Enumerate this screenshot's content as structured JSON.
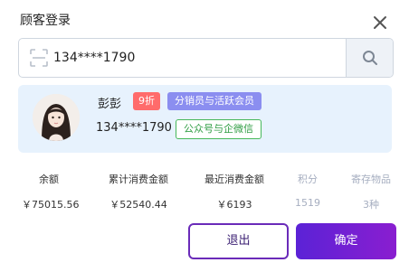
{
  "dialog": {
    "title": "顾客登录"
  },
  "search": {
    "value": "134****1790",
    "placeholder": ""
  },
  "customer": {
    "name": "彭彭",
    "discount_badge": "9折",
    "role_badge": "分销员与活跃会员",
    "phone": "134****1790",
    "channel_badge": "公众号与企微信"
  },
  "stats": [
    {
      "label": "余额",
      "value": "￥75015.56",
      "muted": false
    },
    {
      "label": "累计消费金额",
      "value": "￥52540.44",
      "muted": false
    },
    {
      "label": "最近消费金额",
      "value": "￥6193",
      "muted": false
    },
    {
      "label": "积分",
      "value": "1519",
      "muted": true
    },
    {
      "label": "寄存物品",
      "value": "3种",
      "muted": true
    }
  ],
  "actions": {
    "exit_label": "退出",
    "confirm_label": "确定"
  },
  "colors": {
    "accent": "#6a2bb9",
    "discount_badge": "#ff6b6b",
    "role_badge": "#8b8ef0",
    "channel_badge": "#47b85a",
    "card_bg": "#e7f2fd"
  },
  "icons": {
    "close": "close-icon",
    "scan": "scan-icon",
    "search": "search-icon"
  }
}
